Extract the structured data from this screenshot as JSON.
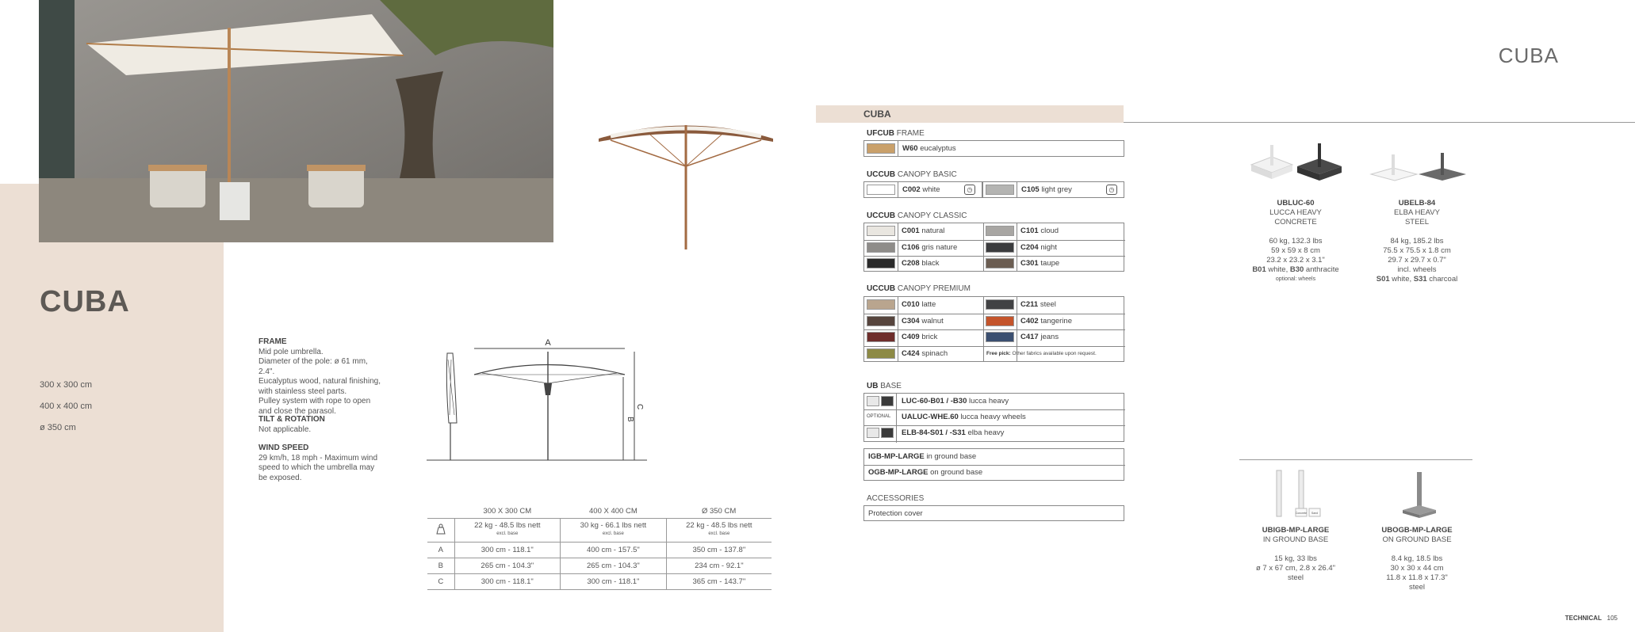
{
  "left": {
    "title": "CUBA",
    "sizes": [
      "300 x 300 cm",
      "400 x 400 cm",
      "ø 350 cm"
    ]
  },
  "specs": {
    "frame_title": "FRAME",
    "frame_lines": [
      "Mid pole umbrella.",
      "Diameter of the pole: ø 61 mm, 2.4\".",
      "Eucalyptus wood, natural finishing,",
      "with stainless steel parts.",
      "Pulley system with rope to open",
      "and close the parasol."
    ],
    "tilt_title": "TILT & ROTATION",
    "tilt_text": "Not applicable.",
    "wind_title": "WIND SPEED",
    "wind_lines": [
      "29 km/h, 18 mph - Maximum wind",
      "speed to which the umbrella may",
      "be exposed."
    ]
  },
  "diagram": {
    "label_a": "A",
    "label_b": "B",
    "label_c": "C"
  },
  "dim_table": {
    "headers": [
      "300 X 300 CM",
      "400 X 400 CM",
      "Ø 350 CM"
    ],
    "weights": [
      "22 kg - 48.5 lbs nett",
      "30 kg - 66.1 lbs nett",
      "22 kg - 48.5 lbs nett"
    ],
    "weight_note": "excl. base",
    "rows": [
      {
        "label": "A",
        "values": [
          "300 cm - 118.1\"",
          "400 cm - 157.5\"",
          "350 cm - 137.8\""
        ]
      },
      {
        "label": "B",
        "values": [
          "265 cm - 104.3\"",
          "265 cm - 104.3\"",
          "234 cm - 92.1\""
        ]
      },
      {
        "label": "C",
        "values": [
          "300 cm - 118.1\"",
          "300 cm - 118.1\"",
          "365 cm - 143.7\""
        ]
      }
    ]
  },
  "right": {
    "page_title": "CUBA",
    "section_title": "CUBA",
    "frame": {
      "code": "UFCUB",
      "name": "FRAME",
      "option": {
        "code": "W60",
        "name": "eucalyptus",
        "color": "#c9a06a"
      }
    },
    "canopy_basic": {
      "code": "UCCUB",
      "name": "CANOPY BASIC",
      "options": [
        {
          "code": "C002",
          "name": "white",
          "color": "#ffffff"
        },
        {
          "code": "C105",
          "name": "light grey",
          "color": "#b4b4b2"
        }
      ]
    },
    "canopy_classic": {
      "code": "UCCUB",
      "name": "CANOPY CLASSIC",
      "options": [
        {
          "code": "C001",
          "name": "natural",
          "color": "#e9e6e0"
        },
        {
          "code": "C101",
          "name": "cloud",
          "color": "#a8a6a3"
        },
        {
          "code": "C106",
          "name": "gris nature",
          "color": "#8e8c89"
        },
        {
          "code": "C204",
          "name": "night",
          "color": "#3b3c3e"
        },
        {
          "code": "C208",
          "name": "black",
          "color": "#2a2a2a"
        },
        {
          "code": "C301",
          "name": "taupe",
          "color": "#6b5d52"
        }
      ]
    },
    "canopy_premium": {
      "code": "UCCUB",
      "name": "CANOPY PREMIUM",
      "options": [
        {
          "code": "C010",
          "name": "latte",
          "color": "#b9a58e"
        },
        {
          "code": "C211",
          "name": "steel",
          "color": "#414244"
        },
        {
          "code": "C304",
          "name": "walnut",
          "color": "#56443d"
        },
        {
          "code": "C402",
          "name": "tangerine",
          "color": "#c4542b"
        },
        {
          "code": "C409",
          "name": "brick",
          "color": "#6e2d2b"
        },
        {
          "code": "C417",
          "name": "jeans",
          "color": "#3b4f70"
        },
        {
          "code": "C424",
          "name": "spinach",
          "color": "#8d8a45"
        }
      ],
      "free_pick_label": "Free pick:",
      "free_pick_text": "Other fabrics available upon request."
    },
    "base": {
      "code": "UB",
      "name": "BASE",
      "options": [
        {
          "code": "LUC-60-B01 / -B30",
          "name": "lucca heavy"
        },
        {
          "tag": "OPTIONAL",
          "code": "UALUC-WHE.60",
          "name": "lucca heavy wheels"
        },
        {
          "code": "ELB-84-S01 / -S31",
          "name": "elba heavy"
        }
      ],
      "ground_options": [
        {
          "code": "IGB-MP-LARGE",
          "name": "in ground base"
        },
        {
          "code": "OGB-MP-LARGE",
          "name": "on ground base"
        }
      ]
    },
    "accessories": {
      "title": "ACCESSORIES",
      "item": "Protection cover"
    },
    "products": [
      {
        "code": "UBLUC-60",
        "lines": [
          "LUCCA HEAVY",
          "CONCRETE"
        ],
        "specs": [
          "60 kg, 132.3 lbs",
          "59 x 59 x 8 cm",
          "23.2 x 23.2 x 3.1\""
        ],
        "colors_b1": "B01",
        "colors_t1": " white, ",
        "colors_b2": "B30",
        "colors_t2": " anthracite",
        "note": "optional: wheels"
      },
      {
        "code": "UBELB-84",
        "lines": [
          "ELBA HEAVY",
          "STEEL"
        ],
        "specs": [
          "84 kg, 185.2 lbs",
          "75.5 x 75.5 x 1.8 cm",
          "29.7 x 29.7 x 0.7\"",
          "incl. wheels"
        ],
        "colors_b1": "S01",
        "colors_t1": " white, ",
        "colors_b2": "S31",
        "colors_t2": " charcoal"
      },
      {
        "code": "UBIGB-MP-LARGE",
        "lines": [
          "IN GROUND BASE"
        ],
        "specs": [
          "15 kg, 33 lbs",
          "ø 7 x 67 cm, 2.8 x 26.4\"",
          "steel"
        ]
      },
      {
        "code": "UBOGB-MP-LARGE",
        "lines": [
          "ON GROUND BASE"
        ],
        "specs": [
          "8.4 kg, 18.5 lbs",
          "30 x 30 x 44 cm",
          "11.8 x 11.8 x 17.3\"",
          "steel"
        ]
      }
    ],
    "product_tags": {
      "in": "Concrete",
      "out": "Sand"
    }
  },
  "footer": {
    "section": "TECHNICAL",
    "page": "105"
  }
}
